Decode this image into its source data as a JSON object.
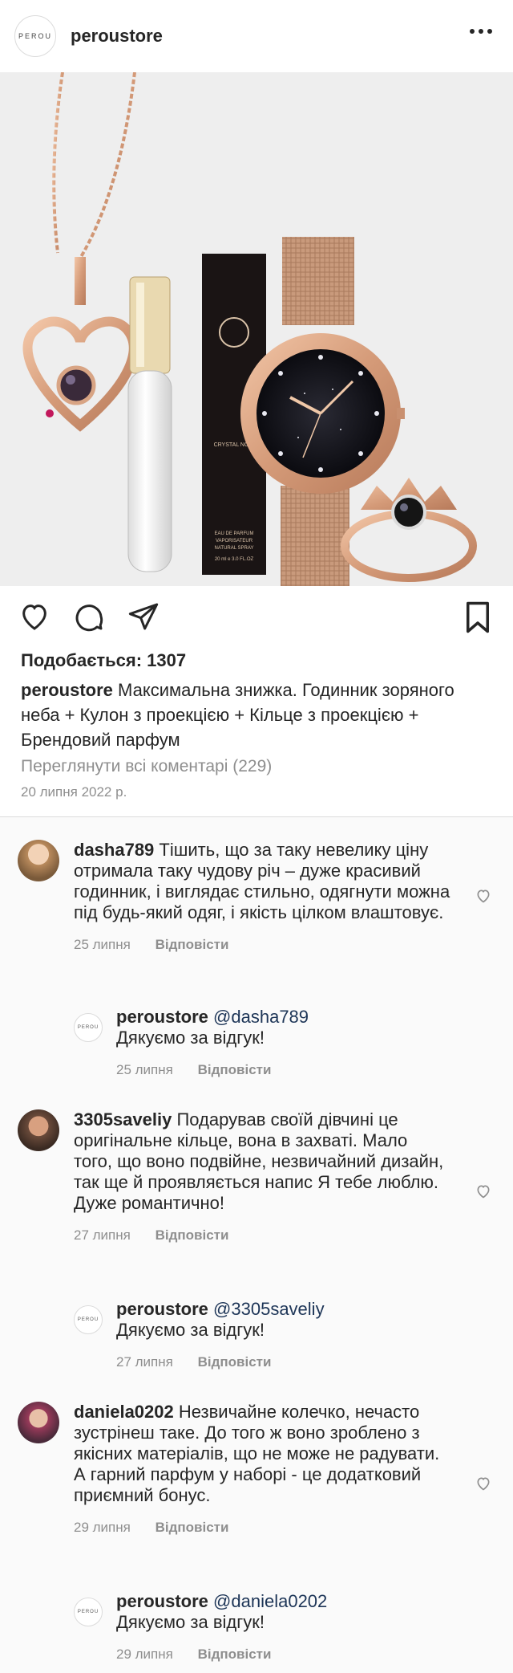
{
  "header": {
    "logo_text": "PEROU",
    "username": "peroustore"
  },
  "post": {
    "image_texts": {
      "perfume_box_brand": "CRYSTAL NOIR",
      "perfume_box_line1": "EAU DE PARFUM",
      "perfume_box_line2": "VAPORISATEUR",
      "perfume_box_line3": "NATURAL SPRAY",
      "perfume_box_volume": "20 ml e 3.0 FL.OZ"
    },
    "likes": "Подобається: 1307",
    "caption_user": "peroustore",
    "caption_text": "Максимальна знижка. Годинник зоряного неба + Кулон з проекцією + Кільце з проекцією + Брендовий парфум",
    "view_comments": "Переглянути всі коментарі (229)",
    "date": "20 липня 2022 р."
  },
  "comments": [
    {
      "user": "dasha789",
      "text": "Тішить, що за таку невелику ціну отримала таку чудову річ – дуже красивий годинник, і виглядає стильно, одягнути можна під будь-який одяг, і якість цілком влаштовує.",
      "date": "25 липня",
      "reply_label": "Відповісти",
      "reply": {
        "user": "peroustore",
        "mention": "@dasha789",
        "text": "Дякуємо за відгук!",
        "date": "25 липня",
        "reply_label": "Відповісти"
      }
    },
    {
      "user": "3305saveliy",
      "text": "Подарував своїй дівчині це оригінальне кільце, вона в захваті. Мало того, що воно подвійне, незвичайний дизайн, так ще й проявляється напис Я тебе люблю. Дуже романтично!",
      "date": "27 липня",
      "reply_label": "Відповісти",
      "reply": {
        "user": "peroustore",
        "mention": "@3305saveliy",
        "text": "Дякуємо за відгук!",
        "date": "27 липня",
        "reply_label": "Відповісти"
      }
    },
    {
      "user": "daniela0202",
      "text": "Незвичайне колечко, нечасто зустрінеш таке. До того ж воно зроблено з якісних матеріалів, що не може не радувати. А гарний парфум у наборі - це додатковий приємний бонус.",
      "date": "29 липня",
      "reply_label": "Відповісти",
      "reply": {
        "user": "peroustore",
        "mention": "@daniela0202",
        "text": "Дякуємо за відгук!",
        "date": "29 липня",
        "reply_label": "Відповісти"
      }
    }
  ]
}
